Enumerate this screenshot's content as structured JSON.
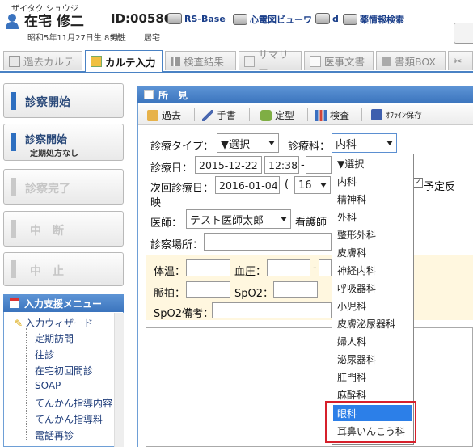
{
  "header": {
    "kana": "ザイタク シュウジ",
    "name": "在宅 修二",
    "id": "ID:00580",
    "links": [
      "RS-Base",
      "心電図ビューワ",
      "d",
      "薬情報検索"
    ],
    "birth": "昭和5年11月27日生 85歳",
    "sex": "男性",
    "place": "居宅"
  },
  "tabs": [
    {
      "label": "過去カルテ",
      "icon": "calendar-icon"
    },
    {
      "label": "カルテ入力",
      "icon": "pencil-icon"
    },
    {
      "label": "検査結果",
      "icon": "chart-icon"
    },
    {
      "label": "サマリー",
      "icon": "summary-icon"
    },
    {
      "label": "医事文書",
      "icon": "document-icon"
    },
    {
      "label": "書類BOX",
      "icon": "box-icon"
    }
  ],
  "left": {
    "start": "診察開始",
    "start_noprx": "診察開始",
    "start_noprx_sub": "定期処方なし",
    "complete": "診察完了",
    "interrupt": "中　断",
    "stop": "中　止",
    "menu_title": "入力支援メニュー",
    "wizard": "入力ウィザード",
    "menu_items": [
      "定期訪問",
      "往診",
      "在宅初回問診",
      "SOAP",
      "てんかん指導内容",
      "てんかん指導料",
      "電話再診"
    ]
  },
  "main": {
    "title": "所　見",
    "toolbar": [
      "過去",
      "手書",
      "定型",
      "検査",
      "ｵﾌﾗｲﾝ保存"
    ],
    "type_label": "診療タイプ：",
    "type_value": "▼選択",
    "dept_label": "診療科：",
    "dept_value": "内科",
    "date_label": "診療日：",
    "date_value": "2015-12-22",
    "time_value": "12:38",
    "next_label": "次回診療日：",
    "next_value": "2016-01-04",
    "paren": "(",
    "next_sel": "16",
    "reflect": "予定反",
    "reflect2": "映",
    "doctor_label": "医師：",
    "doctor_value": "テスト医師太郎",
    "nurse_label": "看護師",
    "place_label": "診察場所：",
    "temp_label": "体温：",
    "bp_label": "血圧：",
    "bp_sep": "-",
    "pulse_label": "脈拍：",
    "spo2_label": "SpO2：",
    "spo2_note_label": "SpO2備考："
  },
  "dropdown": {
    "options": [
      "▼選択",
      "内科",
      "精神科",
      "外科",
      "整形外科",
      "皮膚科",
      "神経内科",
      "呼吸器科",
      "小児科",
      "皮膚泌尿器科",
      "婦人科",
      "泌尿器科",
      "肛門科",
      "麻酔科",
      "眼科",
      "耳鼻いんこう科"
    ],
    "selected": "眼科"
  },
  "colors": {
    "accent": "#3b74bd",
    "highlight": "#2c7fe8",
    "annotation": "#d6202b"
  }
}
